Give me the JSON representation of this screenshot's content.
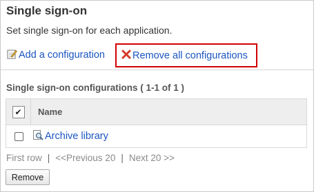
{
  "header": {
    "title": "Single sign-on",
    "description": "Set single sign-on for each application."
  },
  "menu": {
    "add_label": "Add a configuration",
    "remove_all_label": "Remove all configurations"
  },
  "list": {
    "section_title": "Single sign-on configurations ( 1-1 of 1 )",
    "columns": [
      "Name"
    ],
    "rows": [
      {
        "name": "Archive library"
      }
    ]
  },
  "pager": {
    "first": "First row",
    "previous": "<<Previous 20",
    "next": "Next 20 >>",
    "separator": "|"
  },
  "actions": {
    "remove_label": "Remove"
  },
  "colors": {
    "link": "#1a55c0",
    "highlight": "#d10000",
    "header_bg": "#eeeeee"
  }
}
